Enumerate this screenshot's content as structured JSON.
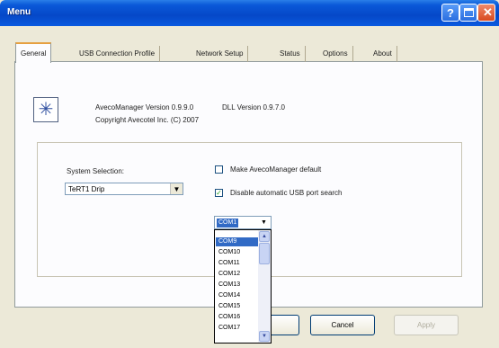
{
  "window": {
    "title": "Menu"
  },
  "titlebar_icons": {
    "help": "?",
    "close": "✕"
  },
  "tabs": [
    {
      "label": "General"
    },
    {
      "label": "USB Connection Profile"
    },
    {
      "label": "Network Setup"
    },
    {
      "label": "Status"
    },
    {
      "label": "Options"
    },
    {
      "label": "About"
    }
  ],
  "about": {
    "icon": "burst-icon",
    "version_line": "AvecoManager Version 0.9.9.0",
    "dll_version": "DLL Version 0.9.7.0",
    "copyright": "Copyright Avecotel Inc. (C) 2007"
  },
  "system_selection": {
    "label": "System Selection:",
    "value": "TeRT1 Drip"
  },
  "options": {
    "make_default_label": "Make AvecoManager default",
    "make_default_checked": false,
    "disable_search_label": "Disable automatic USB port search",
    "disable_search_checked": true
  },
  "port": {
    "selected": "COM1",
    "list": [
      "COM9",
      "COM10",
      "COM11",
      "COM12",
      "COM13",
      "COM14",
      "COM15",
      "COM16",
      "COM17"
    ],
    "highlighted_index": 0
  },
  "buttons": {
    "ok": "",
    "cancel": "Cancel",
    "apply": "Apply"
  }
}
